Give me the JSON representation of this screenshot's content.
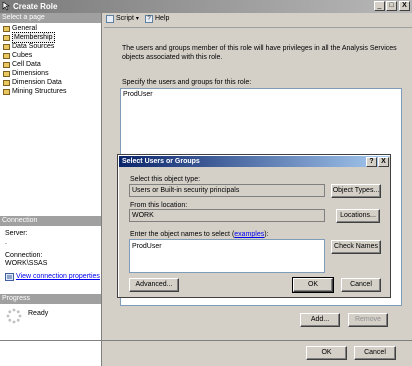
{
  "window": {
    "title": "Create Role",
    "minimize": "_",
    "maximize": "□",
    "close": "X"
  },
  "left_panel": {
    "select_page_header": "Select a page",
    "pages": [
      {
        "label": "General",
        "selected": false
      },
      {
        "label": "Membership",
        "selected": true
      },
      {
        "label": "Data Sources",
        "selected": false
      },
      {
        "label": "Cubes",
        "selected": false
      },
      {
        "label": "Cell Data",
        "selected": false
      },
      {
        "label": "Dimensions",
        "selected": false
      },
      {
        "label": "Dimension Data",
        "selected": false
      },
      {
        "label": "Mining Structures",
        "selected": false
      }
    ],
    "connection_header": "Connection",
    "server_label": "Server:",
    "server_value": ".",
    "connection_label": "Connection:",
    "connection_value": "WORK\\SSAS",
    "view_connection_link": "View connection properties",
    "progress_header": "Progress",
    "progress_status": "Ready"
  },
  "toolbar": {
    "script_label": "Script",
    "help_label": "Help"
  },
  "main": {
    "description": "The users and groups member of this role will have privileges in all the Analysis Services objects associated with this role.",
    "specify_label": "Specify the users and groups for this role:",
    "members": [
      "ProdUser"
    ],
    "add_button": "Add...",
    "remove_button": "Remove",
    "ok_button": "OK",
    "cancel_button": "Cancel"
  },
  "dialog": {
    "title": "Select Users or Groups",
    "help_btn": "?",
    "close_btn": "X",
    "object_type_label": "Select this object type:",
    "object_type_value": "Users or Built-in security principals",
    "object_types_button": "Object Types...",
    "location_label": "From this location:",
    "location_value": "WORK",
    "locations_button": "Locations...",
    "enter_names_label": "Enter the object names to select (",
    "examples_link": "examples",
    "enter_names_suffix": "):",
    "names_value": "ProdUser",
    "check_names_button": "Check Names",
    "advanced_button": "Advanced...",
    "ok_button": "OK",
    "cancel_button": "Cancel"
  },
  "colors": {
    "dialog_title_start": "#0a246a",
    "dialog_title_end": "#a6caf0",
    "link": "#0000ee"
  }
}
